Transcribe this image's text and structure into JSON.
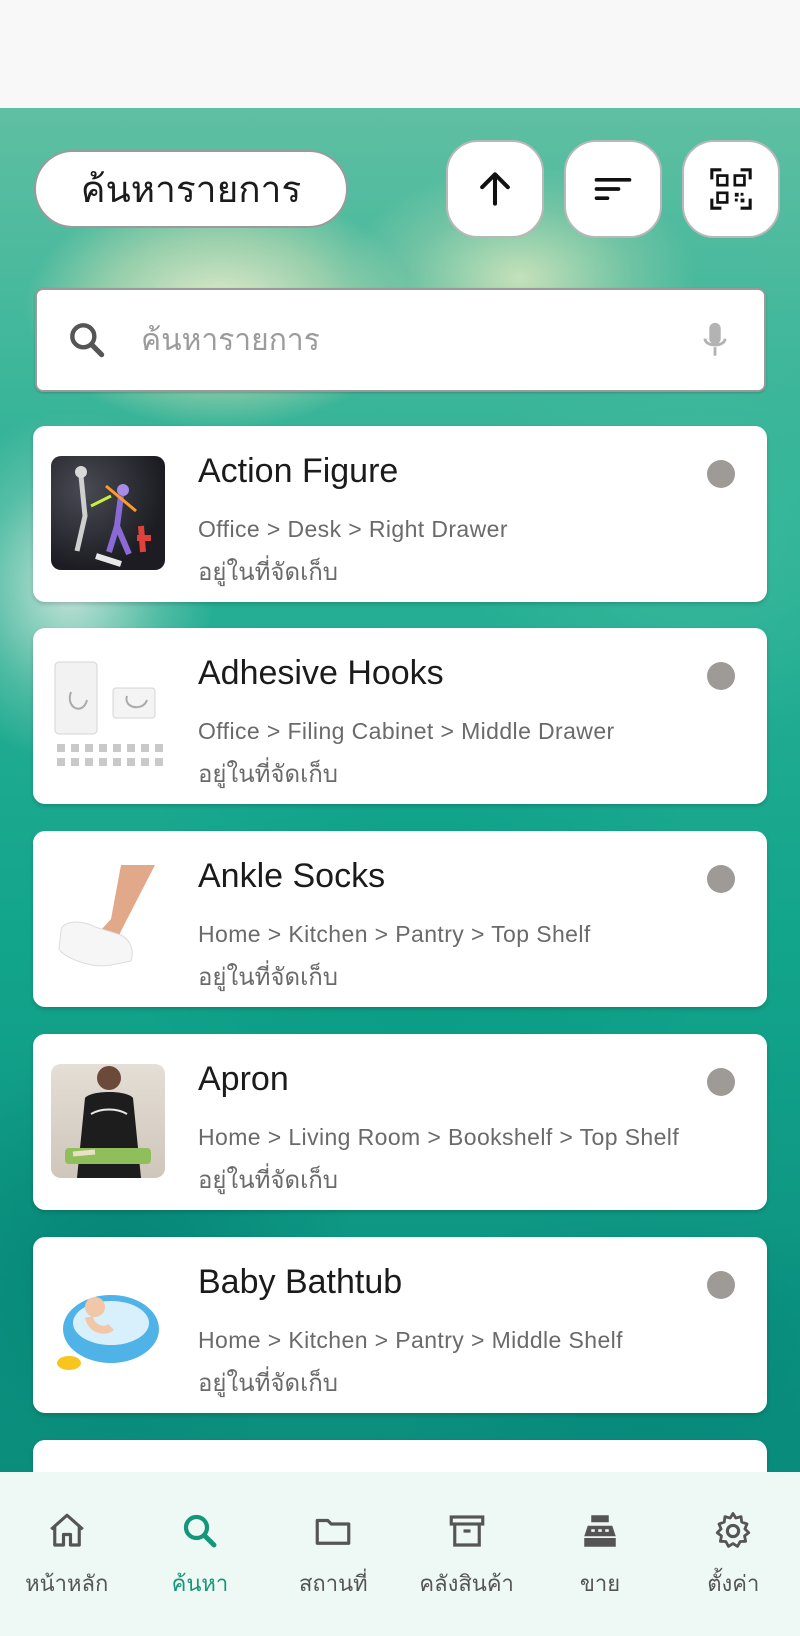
{
  "header": {
    "title": "ค้นหารายการ",
    "buttons": [
      {
        "icon": "arrow-up-icon"
      },
      {
        "icon": "sort-icon"
      },
      {
        "icon": "qr-code-icon"
      }
    ]
  },
  "search": {
    "placeholder": "ค้นหารายการ",
    "value": ""
  },
  "items": [
    {
      "name": "Action Figure",
      "path": "Office > Desk > Right Drawer",
      "status": "อยู่ในที่จัดเก็บ",
      "status_color": "#9e9a96"
    },
    {
      "name": "Adhesive Hooks",
      "path": "Office > Filing Cabinet > Middle Drawer",
      "status": "อยู่ในที่จัดเก็บ",
      "status_color": "#9e9a96"
    },
    {
      "name": "Ankle Socks",
      "path": "Home > Kitchen > Pantry > Top Shelf",
      "status": "อยู่ในที่จัดเก็บ",
      "status_color": "#9e9a96"
    },
    {
      "name": "Apron",
      "path": "Home > Living Room > Bookshelf > Top Shelf",
      "status": "อยู่ในที่จัดเก็บ",
      "status_color": "#9e9a96"
    },
    {
      "name": "Baby Bathtub",
      "path": "Home > Kitchen > Pantry > Middle Shelf",
      "status": "อยู่ในที่จัดเก็บ",
      "status_color": "#9e9a96"
    }
  ],
  "nav": {
    "active": "search",
    "accent_color": "#14967a",
    "items": [
      {
        "key": "home",
        "label": "หน้าหลัก",
        "icon": "home-icon"
      },
      {
        "key": "search",
        "label": "ค้นหา",
        "icon": "search-icon"
      },
      {
        "key": "places",
        "label": "สถานที่",
        "icon": "folder-icon"
      },
      {
        "key": "inventory",
        "label": "คลังสินค้า",
        "icon": "archive-icon"
      },
      {
        "key": "sell",
        "label": "ขาย",
        "icon": "cash-register-icon"
      },
      {
        "key": "settings",
        "label": "ตั้งค่า",
        "icon": "gear-icon"
      }
    ]
  }
}
